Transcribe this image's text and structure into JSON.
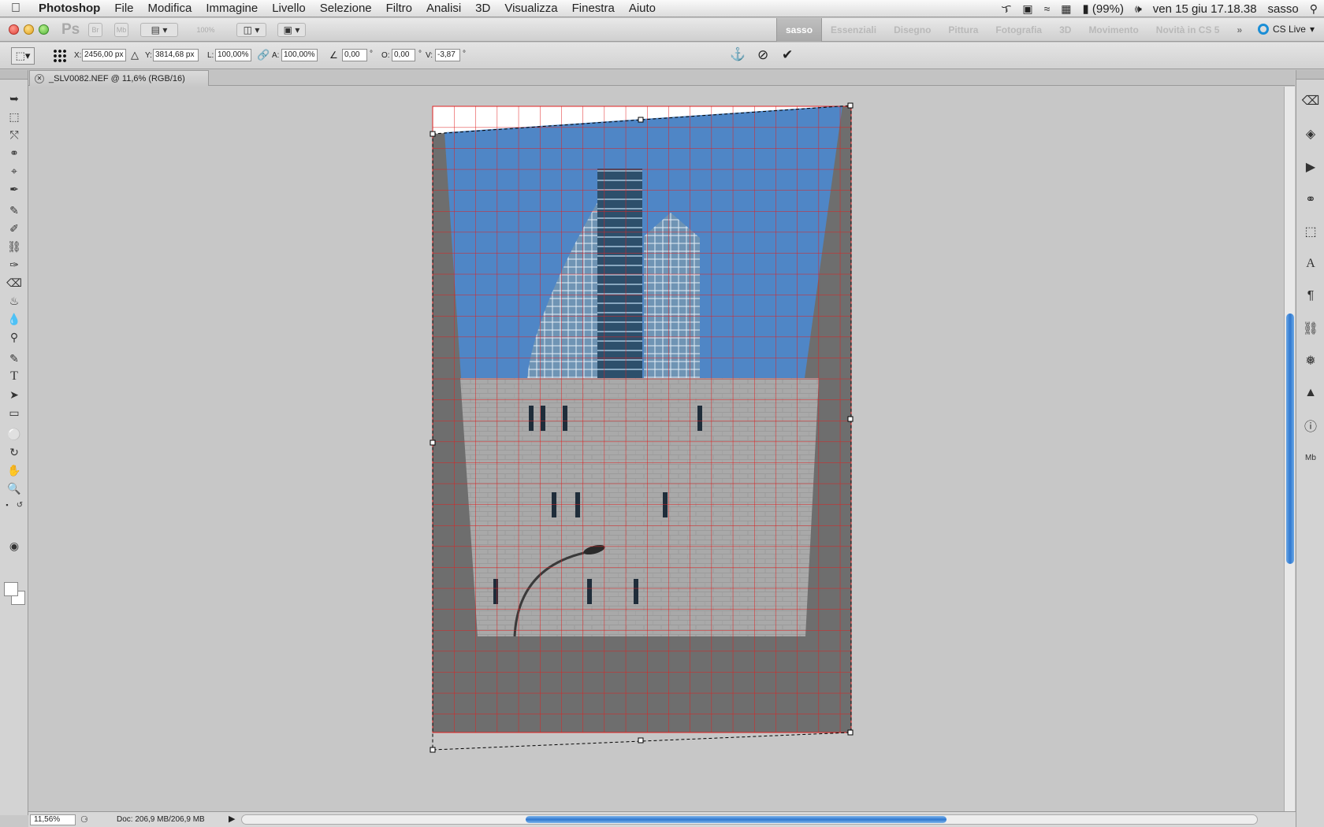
{
  "menubar": {
    "app_name": "Photoshop",
    "items": [
      "File",
      "Modifica",
      "Immagine",
      "Livello",
      "Selezione",
      "Filtro",
      "Analisi",
      "3D",
      "Visualizza",
      "Finestra",
      "Aiuto"
    ],
    "battery": "(99%)",
    "datetime": "ven 15 giu  17.18.38",
    "user": "sasso"
  },
  "appbar": {
    "ps_label": "Ps",
    "br_label": "Br",
    "mb_label": "Mb",
    "zoom_label": "100%",
    "workspaces": [
      "sasso",
      "Essenziali",
      "Disegno",
      "Pittura",
      "Fotografia",
      "3D",
      "Movimento",
      "Novità in CS 5"
    ],
    "active_workspace": "sasso",
    "more": "»",
    "cslive": "CS Live"
  },
  "options": {
    "x_label": "X:",
    "x_value": "2456,00 px",
    "y_label": "Y:",
    "y_value": "3814,68 px",
    "w_label": "L:",
    "w_value": "100,00%",
    "h_label": "A:",
    "h_value": "100,00%",
    "angle_value": "0,00",
    "hskew_label": "O:",
    "hskew_value": "0,00",
    "vskew_label": "V:",
    "vskew_value": "-3,87",
    "degree": "°"
  },
  "document": {
    "tab_title": "_SLV0082.NEF @ 11,6% (RGB/16)"
  },
  "status": {
    "zoom": "11,56%",
    "doc_info": "Doc: 206,9 MB/206,9 MB"
  },
  "colors": {
    "grid": "#e02020",
    "sky": "#4f86c6",
    "building": "#a9a9a9",
    "background_fill": "#6e6e6e",
    "accent": "#2f78d0"
  }
}
